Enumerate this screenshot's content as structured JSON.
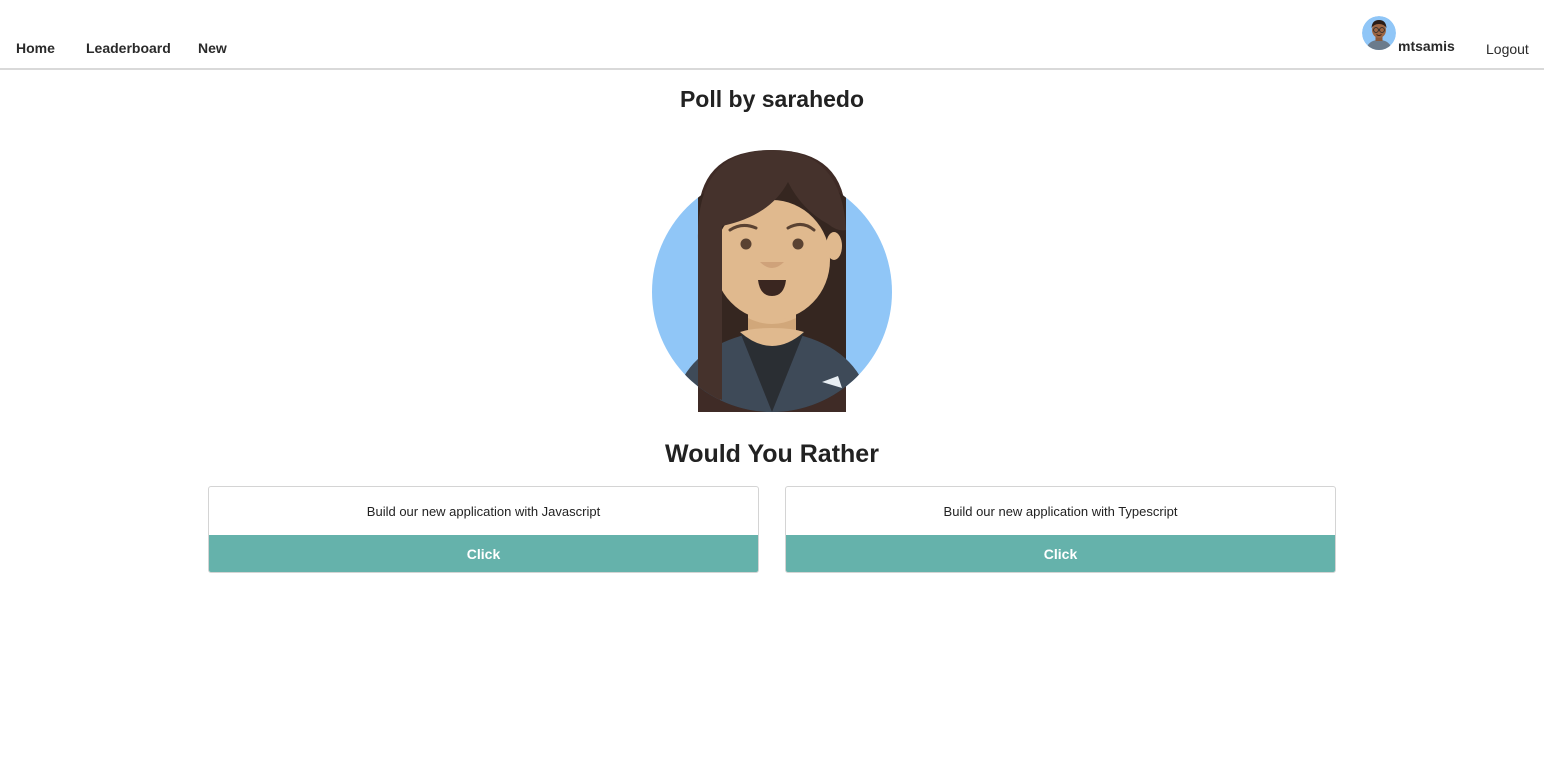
{
  "nav": {
    "home": "Home",
    "leaderboard": "Leaderboard",
    "new": "New",
    "logout": "Logout"
  },
  "user": {
    "name": "mtsamis",
    "avatar_icon": "user-avatar-glasses"
  },
  "poll": {
    "title": "Poll by sarahedo",
    "author_avatar_icon": "woman-avatar",
    "heading": "Would You Rather",
    "options": [
      {
        "text": "Build our new application with Javascript",
        "button": "Click"
      },
      {
        "text": "Build our new application with Typescript",
        "button": "Click"
      }
    ]
  },
  "colors": {
    "accent": "#65b2ab",
    "avatar_bg": "#90c6f7",
    "nav_border": "#d9d9d9"
  }
}
